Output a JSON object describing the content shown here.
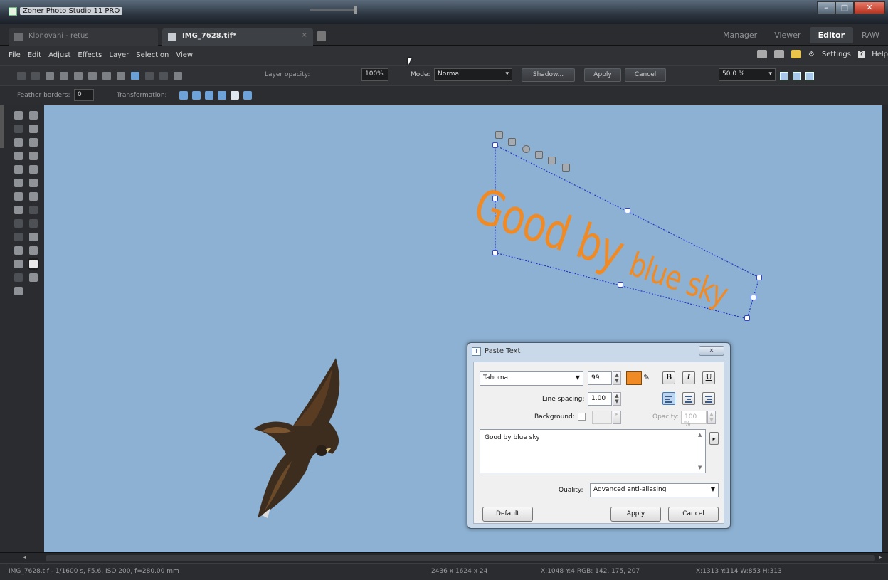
{
  "window": {
    "title": "Zoner Photo Studio 11 PRO"
  },
  "tabs": [
    {
      "label": "Klonovani - retus",
      "active": false
    },
    {
      "label": "IMG_7628.tif*",
      "active": true
    }
  ],
  "modes": [
    "Manager",
    "Viewer",
    "Editor",
    "RAW"
  ],
  "active_mode": "Editor",
  "menu": [
    "File",
    "Edit",
    "Adjust",
    "Effects",
    "Layer",
    "Selection",
    "View"
  ],
  "menu_right": {
    "settings": "Settings",
    "help": "Help"
  },
  "toolbar": {
    "layer_opacity_label": "Layer opacity:",
    "layer_opacity_value": "100%",
    "mode_label": "Mode:",
    "mode_value": "Normal",
    "shadow_button": "Shadow...",
    "apply_button": "Apply",
    "cancel_button": "Cancel",
    "zoom_value": "50.0 %"
  },
  "toolbar2": {
    "feather_label": "Feather borders:",
    "feather_value": "0",
    "transformation_label": "Transformation:"
  },
  "canvas_text": {
    "main": "Good by",
    "tail": "blue sky",
    "color": "#f08a24"
  },
  "dialog": {
    "title": "Paste Text",
    "font": "Tahoma",
    "font_size": "99",
    "color": "#f08a24",
    "bold": "B",
    "italic": "I",
    "underline": "U",
    "line_spacing_label": "Line spacing:",
    "line_spacing_value": "1.00",
    "background_label": "Background:",
    "opacity_label": "Opacity:",
    "opacity_value": "100 %",
    "text": "Good by blue sky",
    "quality_label": "Quality:",
    "quality_value": "Advanced anti-aliasing",
    "default_button": "Default",
    "apply_button": "Apply",
    "cancel_button": "Cancel"
  },
  "status": {
    "file_info": "IMG_7628.tif - 1/1600 s, F5.6, ISO 200, f=280.00 mm",
    "dimensions": "2436 x 1624 x 24",
    "cursor_info": "X:1048 Y:4  RGB: 142, 175, 207",
    "selection_info": "X:1313  Y:114  W:853  H:313"
  }
}
